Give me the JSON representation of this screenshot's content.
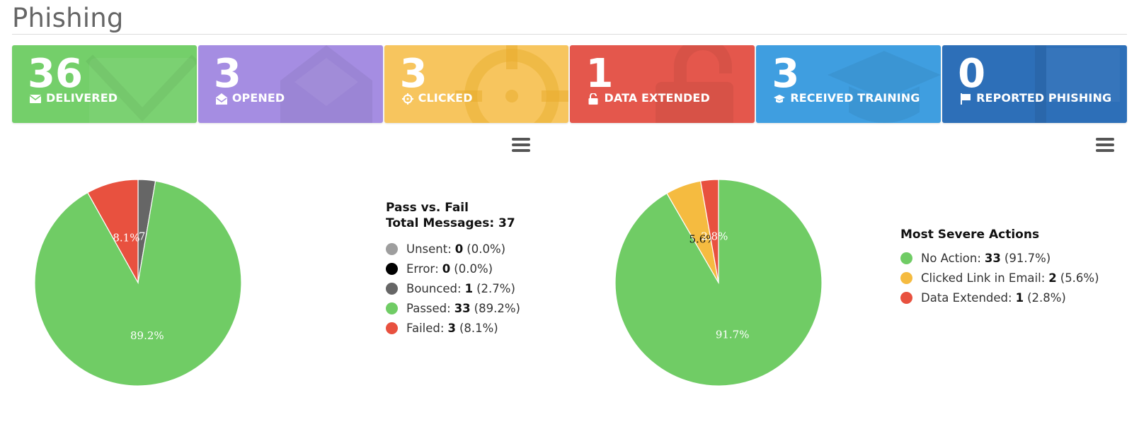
{
  "page": {
    "title": "Phishing"
  },
  "tiles": [
    {
      "count": "36",
      "label": "DELIVERED",
      "icon": "envelope-icon",
      "color": "#74cf6a"
    },
    {
      "count": "3",
      "label": "OPENED",
      "icon": "envelope-open-icon",
      "color": "#a58de2"
    },
    {
      "count": "3",
      "label": "CLICKED",
      "icon": "crosshairs-icon",
      "color": "#f7c55e"
    },
    {
      "count": "1",
      "label": "DATA EXTENDED",
      "icon": "unlock-icon",
      "color": "#e4574c"
    },
    {
      "count": "3",
      "label": "RECEIVED TRAINING",
      "icon": "graduation-cap-icon",
      "color": "#3f9ee0"
    },
    {
      "count": "0",
      "label": "REPORTED PHISHING",
      "icon": "flag-icon",
      "color": "#2d6fb8"
    }
  ],
  "chart_data": [
    {
      "type": "pie",
      "title": "Pass vs. Fail",
      "subtitle": "Total Messages: 37",
      "legend_position": "right",
      "slices": [
        {
          "name": "Unsent",
          "value": 0,
          "percent": "0.0%",
          "color": "#9e9e9e"
        },
        {
          "name": "Error",
          "value": 0,
          "percent": "0.0%",
          "color": "#000000"
        },
        {
          "name": "Bounced",
          "value": 1,
          "percent": "2.7%",
          "color": "#666666"
        },
        {
          "name": "Passed",
          "value": 33,
          "percent": "89.2%",
          "color": "#70cc65"
        },
        {
          "name": "Failed",
          "value": 3,
          "percent": "8.1%",
          "color": "#e8513f"
        }
      ]
    },
    {
      "type": "pie",
      "title": "Most Severe Actions",
      "legend_position": "right",
      "slices": [
        {
          "name": "No Action",
          "value": 33,
          "percent": "91.7%",
          "color": "#70cc65"
        },
        {
          "name": "Clicked Link in Email",
          "value": 2,
          "percent": "5.6%",
          "color": "#f5bb40"
        },
        {
          "name": "Data Extended",
          "value": 1,
          "percent": "2.8%",
          "color": "#e8513f"
        }
      ]
    }
  ]
}
